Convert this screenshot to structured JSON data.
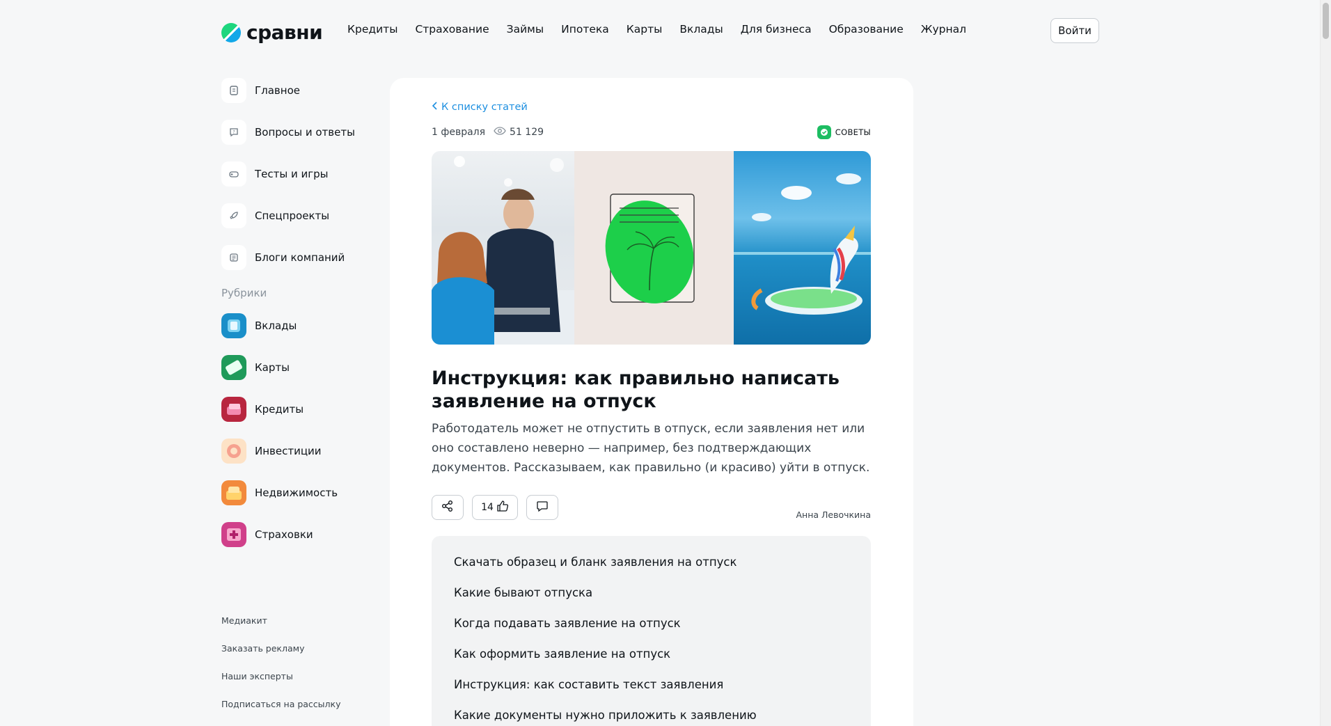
{
  "header": {
    "logo_text": "сравни",
    "nav": [
      "Кредиты",
      "Страхование",
      "Займы",
      "Ипотека",
      "Карты",
      "Вклады",
      "Для бизнеса",
      "Образование",
      "Журнал"
    ],
    "login_label": "Войти"
  },
  "sidebar": {
    "items": [
      {
        "label": "Главное",
        "icon": "document-icon"
      },
      {
        "label": "Вопросы и ответы",
        "icon": "question-icon"
      },
      {
        "label": "Тесты и игры",
        "icon": "gamepad-icon"
      },
      {
        "label": "Спецпроекты",
        "icon": "rocket-icon"
      },
      {
        "label": "Блоги компаний",
        "icon": "blog-icon"
      }
    ],
    "rubrics_title": "Рубрики",
    "rubrics": [
      {
        "label": "Вклады",
        "color": "#1a8fc9"
      },
      {
        "label": "Карты",
        "color": "#1f9a5a"
      },
      {
        "label": "Кредиты",
        "color": "#b8263f"
      },
      {
        "label": "Инвестиции",
        "color": "#f6b98a"
      },
      {
        "label": "Недвижимость",
        "color": "#f28a3c"
      },
      {
        "label": "Страховки",
        "color": "#d0408a"
      }
    ],
    "footer_links": [
      "Медиакит",
      "Заказать рекламу",
      "Наши эксперты",
      "Подписаться на рассылку"
    ]
  },
  "article": {
    "back_label": "К списку статей",
    "date": "1 февраля",
    "views": "51 129",
    "badge": "СОВЕТЫ",
    "title": "Инструкция: как правильно написать заявление на отпуск",
    "lead": "Работодатель может не отпустить в отпуск, если заявления нет или оно составлено неверно — например, без подтверждающих документов. Рассказываем, как правильно (и красиво) уйти в отпуск.",
    "likes": "14",
    "author": "Анна Левочкина",
    "toc": [
      "Скачать образец и бланк заявления на отпуск",
      "Какие бывают отпуска",
      "Когда подавать заявление на отпуск",
      "Как оформить заявление на отпуск",
      "Инструкция: как составить текст заявления",
      "Какие документы нужно приложить к заявлению"
    ]
  },
  "colors": {
    "accent": "#1d8fe0",
    "badge": "#1dbd62"
  }
}
